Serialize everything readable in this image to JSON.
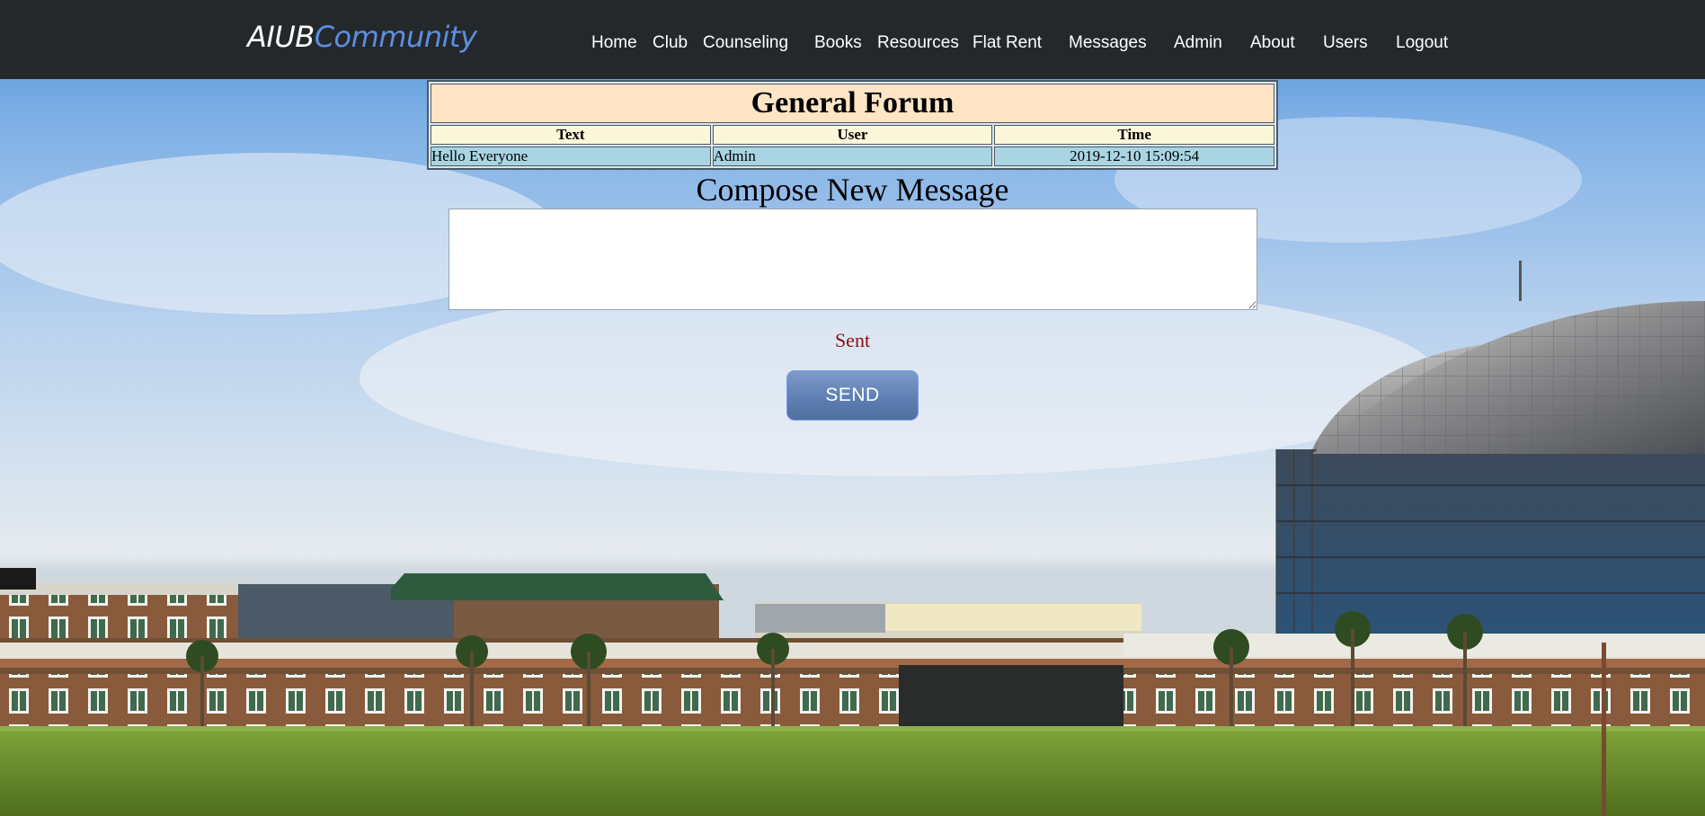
{
  "brand": {
    "part1": "AIUB",
    "part2": "Community"
  },
  "nav": {
    "home": "Home",
    "club": "Club",
    "counseling": "Counseling",
    "books": "Books",
    "resources": "Resources",
    "flat_rent": "Flat Rent",
    "messages": "Messages",
    "admin": "Admin",
    "about": "About",
    "users": "Users",
    "logout": "Logout"
  },
  "forum": {
    "title": "General Forum",
    "columns": {
      "text": "Text",
      "user": "User",
      "time": "Time"
    },
    "rows": [
      {
        "text": "Hello Everyone",
        "user": "Admin",
        "time": "2019-12-10 15:09:54"
      }
    ]
  },
  "compose": {
    "title": "Compose New Message",
    "message_value": "",
    "status": "Sent",
    "send_label": "SEND"
  },
  "colors": {
    "navbar_bg": "#25282b",
    "brand_accent": "#5b8fe0",
    "forum_title_bg": "#ffe4c6",
    "forum_header_bg": "#fdf7d9",
    "forum_row_bg": "#a9d5e3",
    "status_text": "#8b0f0f",
    "send_button": "#5f7fb5"
  },
  "background": {
    "image": "AIUB campus building with glass dome under blue sky, green lawn"
  }
}
